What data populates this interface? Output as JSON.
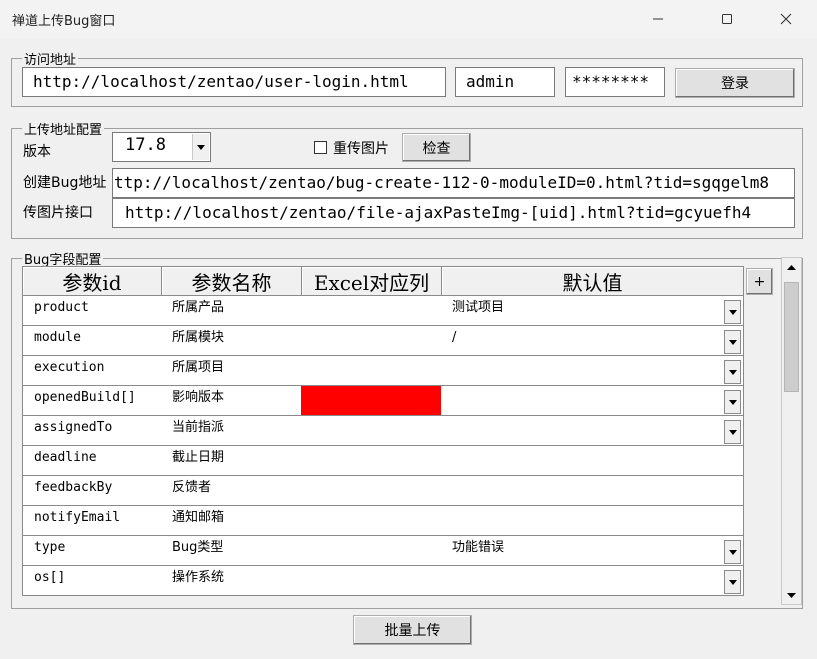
{
  "window": {
    "title": "禅道上传Bug窗口"
  },
  "access": {
    "legend": "访问地址",
    "url": "http://localhost/zentao/user-login.html",
    "username": "admin",
    "password": "********",
    "login_label": "登录"
  },
  "upload_config": {
    "legend": "上传地址配置",
    "version_label": "版本",
    "version_value": "17.8",
    "reupload_label": "重传图片",
    "check_label": "检查",
    "create_bug_label": "创建Bug地址",
    "create_bug_url": "ttp://localhost/zentao/bug-create-112-0-moduleID=0.html?tid=sgqgelm8",
    "img_api_label": "传图片接口",
    "img_api_url": "http://localhost/zentao/file-ajaxPasteImg-[uid].html?tid=gcyuefh4"
  },
  "bug_fields": {
    "legend": "Bug字段配置",
    "add_label": "+",
    "columns": [
      "参数id",
      "参数名称",
      "Excel对应列",
      "默认值"
    ],
    "rows": [
      {
        "id": "product",
        "name": "所属产品",
        "excel": "",
        "default": "测试项目",
        "dropdown": true,
        "highlight": false
      },
      {
        "id": "module",
        "name": "所属模块",
        "excel": "",
        "default": "/",
        "dropdown": true,
        "highlight": false
      },
      {
        "id": "execution",
        "name": "所属项目",
        "excel": "",
        "default": "",
        "dropdown": true,
        "highlight": false
      },
      {
        "id": "openedBuild[]",
        "name": "影响版本",
        "excel": "",
        "default": "",
        "dropdown": true,
        "highlight": true
      },
      {
        "id": "assignedTo",
        "name": "当前指派",
        "excel": "",
        "default": "",
        "dropdown": true,
        "highlight": false
      },
      {
        "id": "deadline",
        "name": "截止日期",
        "excel": "",
        "default": "",
        "dropdown": false,
        "highlight": false
      },
      {
        "id": "feedbackBy",
        "name": "反馈者",
        "excel": "",
        "default": "",
        "dropdown": false,
        "highlight": false
      },
      {
        "id": "notifyEmail",
        "name": "通知邮箱",
        "excel": "",
        "default": "",
        "dropdown": false,
        "highlight": false
      },
      {
        "id": "type",
        "name": "Bug类型",
        "excel": "",
        "default": "功能错误",
        "dropdown": true,
        "highlight": false
      },
      {
        "id": "os[]",
        "name": "操作系统",
        "excel": "",
        "default": "",
        "dropdown": true,
        "highlight": false
      }
    ]
  },
  "batch_upload_label": "批量上传",
  "colors": {
    "highlight": "#ff0000",
    "window_bg": "#f0f0f0"
  }
}
